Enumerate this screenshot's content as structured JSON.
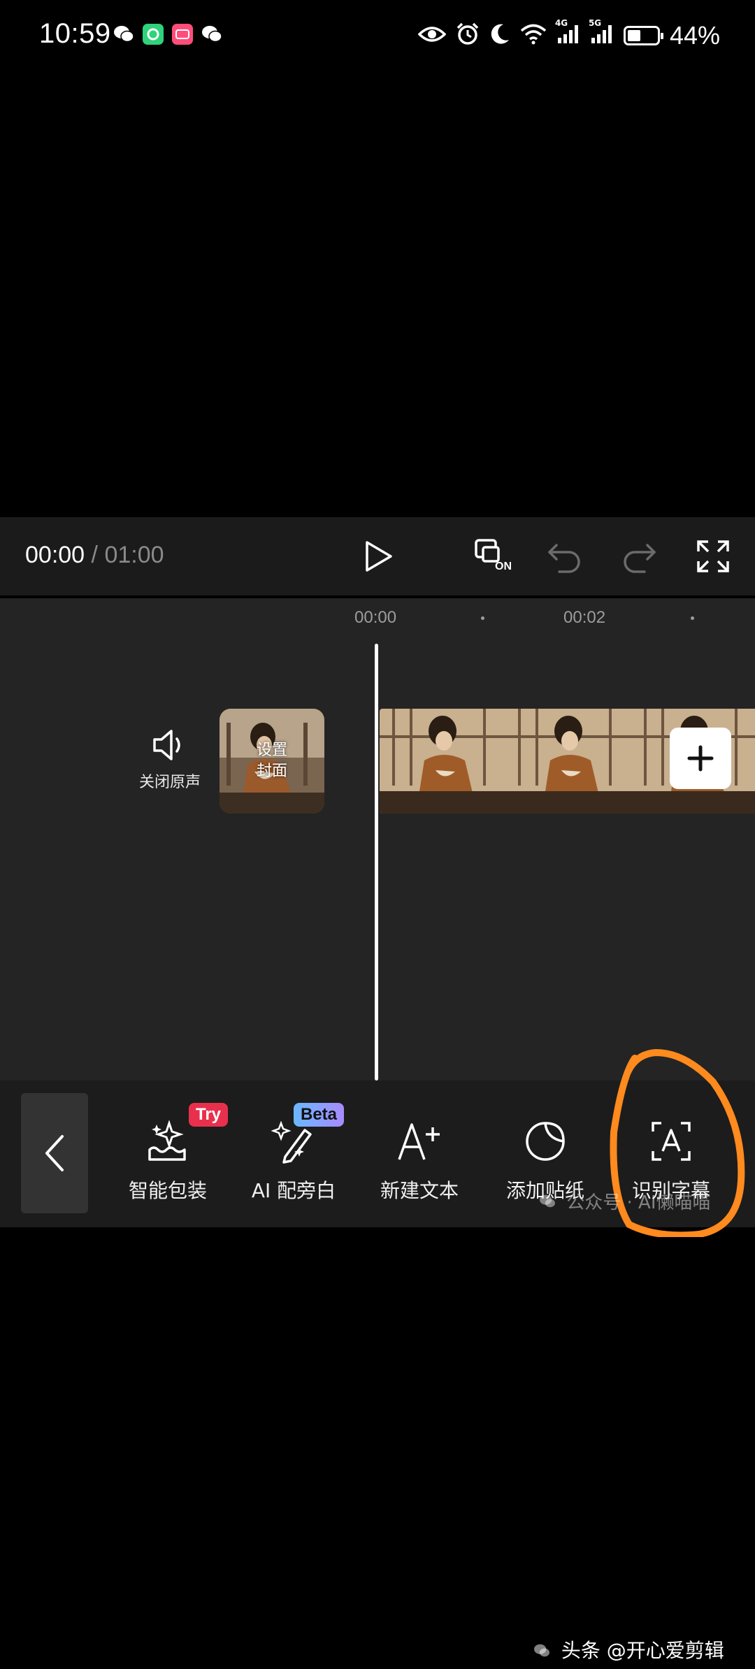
{
  "status_bar": {
    "time": "10:59",
    "battery_text": "44%",
    "battery_level": 0.44,
    "network_1": "4G",
    "network_2": "5G"
  },
  "player": {
    "current_time": "00:00",
    "separator": "/",
    "total_time": "01:00",
    "icons": [
      "play-icon",
      "hd-on-icon",
      "undo-icon",
      "redo-icon",
      "fullscreen-icon"
    ],
    "hd_badge": "ON"
  },
  "timeline": {
    "ruler": [
      "00:00",
      "00:02"
    ],
    "mute_label": "关闭原声",
    "cover_label_line1": "设置",
    "cover_label_line2": "封面"
  },
  "toolbar": {
    "items": [
      {
        "label": "智能包装",
        "icon": "smart-package-icon",
        "badge": "Try"
      },
      {
        "label": "AI 配旁白",
        "icon": "ai-narration-icon",
        "badge": "Beta"
      },
      {
        "label": "新建文本",
        "icon": "new-text-icon"
      },
      {
        "label": "添加贴纸",
        "icon": "sticker-icon"
      },
      {
        "label": "识别字幕",
        "icon": "recognize-subtitle-icon"
      }
    ]
  },
  "watermarks": {
    "wechat": "公众号 · AI懒喵喵",
    "toutiao": "头条 @开心爱剪辑"
  },
  "colors": {
    "accent_annotation": "#ff8a1e",
    "try_badge": "#e8304d"
  }
}
